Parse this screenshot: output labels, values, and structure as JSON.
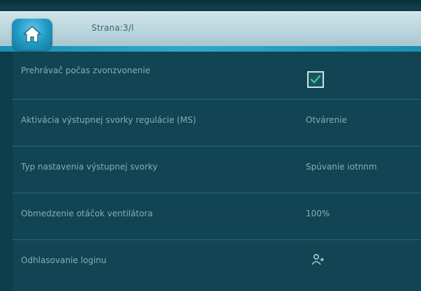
{
  "header": {
    "title": "Strana:3/l",
    "home_icon": "home-icon"
  },
  "colors": {
    "header_bg": "#c3dbe2",
    "accent": "#2fa9c9",
    "panel_bg": "#114553",
    "text": "#7fb0bc"
  },
  "settings": {
    "rows": [
      {
        "label": "Prehrávač počas zvonzvonenie",
        "control": "checkbox",
        "checked": true
      },
      {
        "label": "Aktivácia výstupnej svorky regulácie (MS)",
        "value": "Otvárenie"
      },
      {
        "label": "Typ nastavenia výstupnej svorky",
        "value": "Spúvanie iotnnm"
      },
      {
        "label": "Obmedzenie otáčok ventilátora",
        "value": "100%"
      },
      {
        "label": "Odhlasovanie loginu",
        "control": "icon",
        "icon": "logout-icon"
      }
    ]
  }
}
